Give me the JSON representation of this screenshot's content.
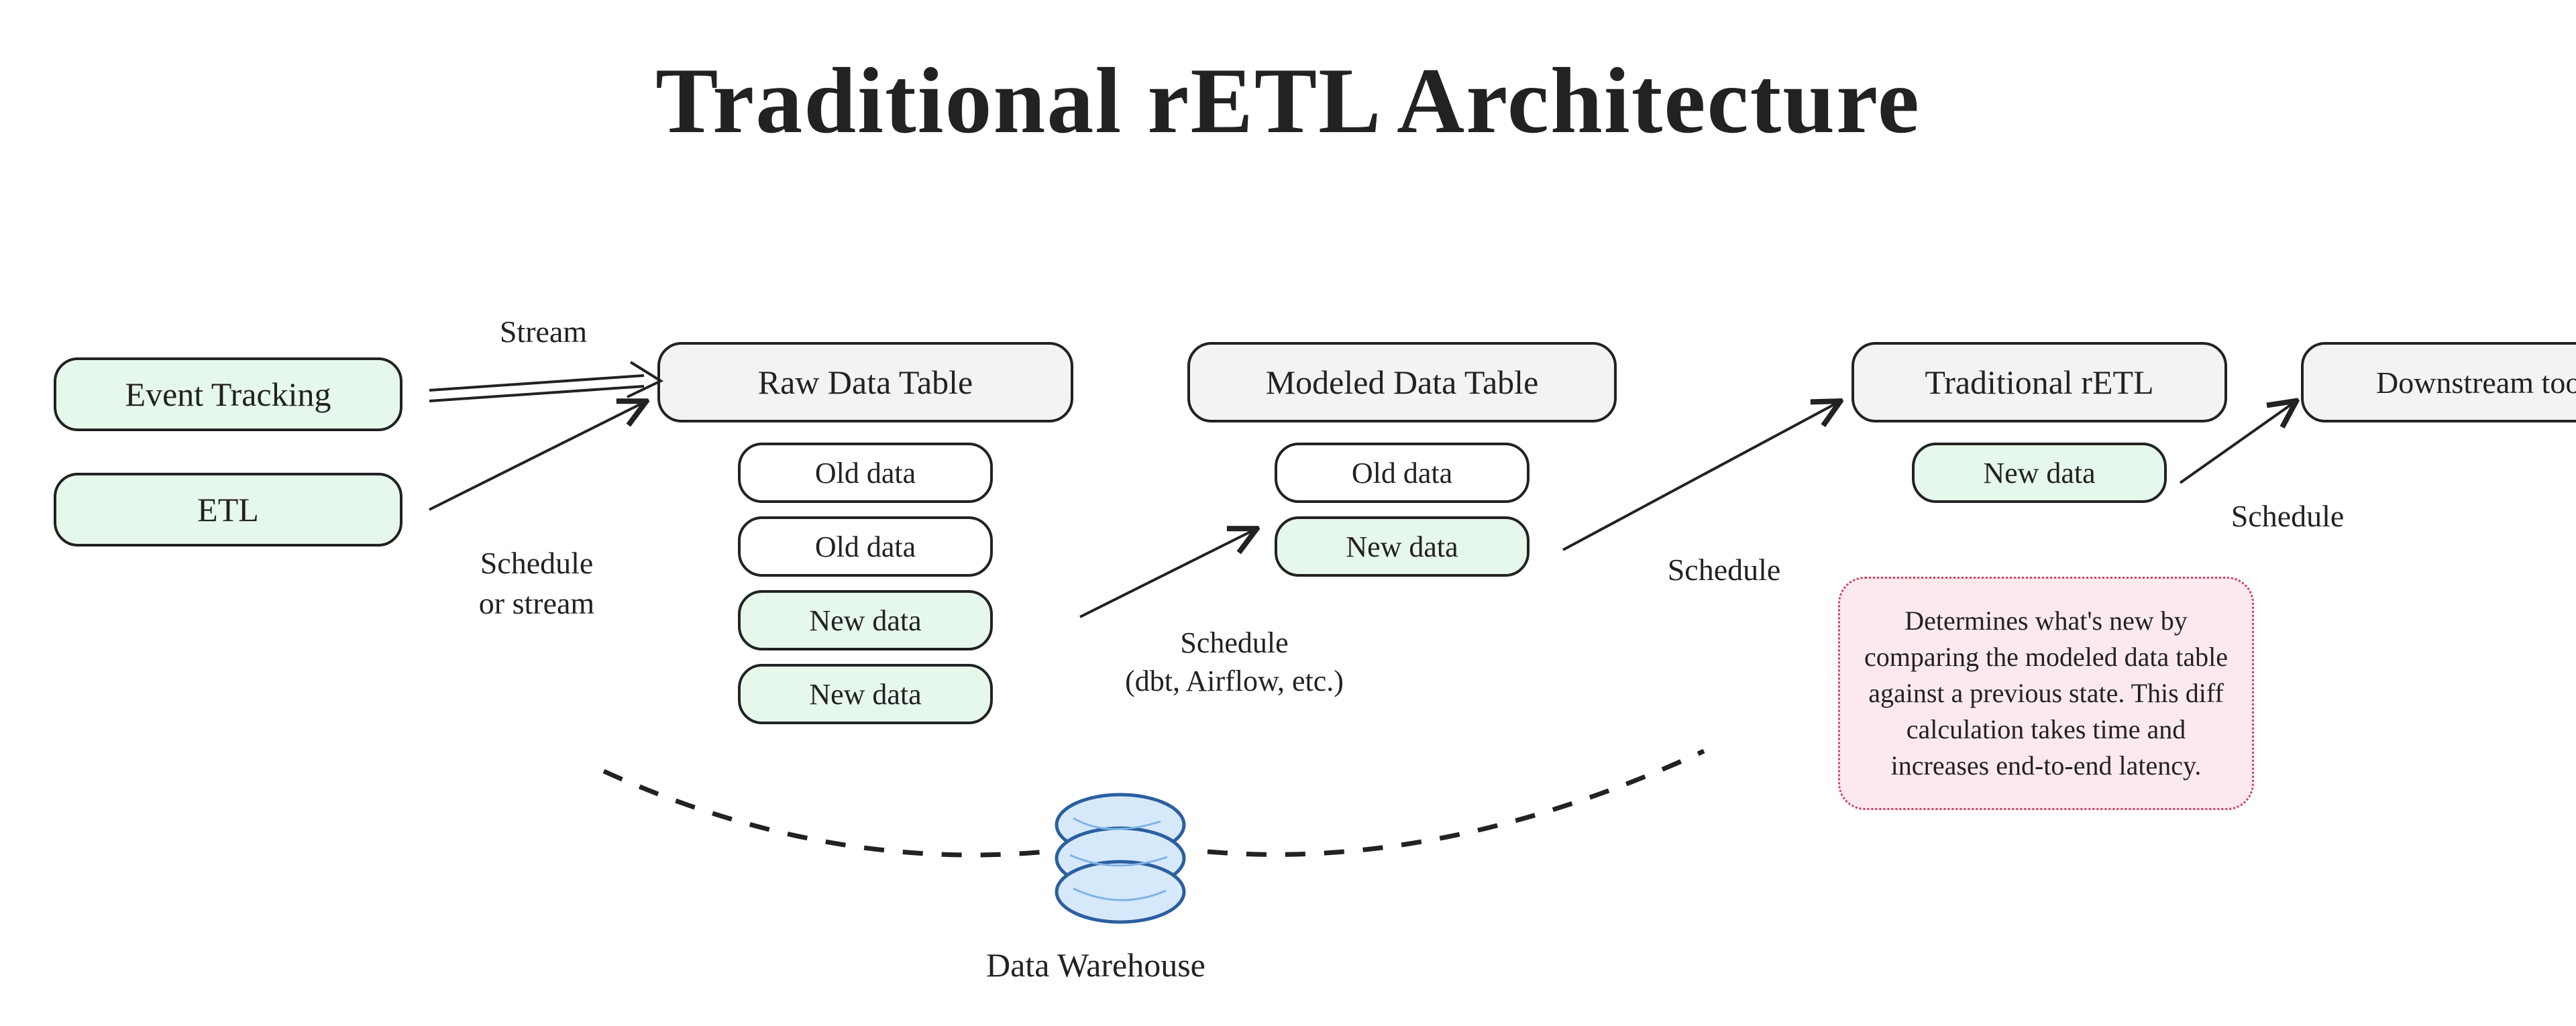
{
  "title": "Traditional rETL Architecture",
  "nodes": {
    "event_tracking": "Event Tracking",
    "etl": "ETL",
    "raw_table": "Raw Data Table",
    "modeled_table": "Modeled Data Table",
    "traditional_retl": "Traditional rETL",
    "downstream_tools": "Downstream tools"
  },
  "raw_rows": {
    "r1": "Old data",
    "r2": "Old data",
    "r3": "New data",
    "r4": "New data"
  },
  "modeled_rows": {
    "m1": "Old data",
    "m2": "New data"
  },
  "retl_rows": {
    "t1": "New data"
  },
  "edge_labels": {
    "stream": "Stream",
    "schedule_or_stream": "Schedule\nor stream",
    "schedule_dbt": "Schedule\n(dbt, Airflow, etc.)",
    "schedule_1": "Schedule",
    "schedule_2": "Schedule"
  },
  "data_warehouse": "Data Warehouse",
  "note": "Determines what's new by comparing the modeled data table against a previous state. This diff calculation takes time and increases end-to-end latency."
}
